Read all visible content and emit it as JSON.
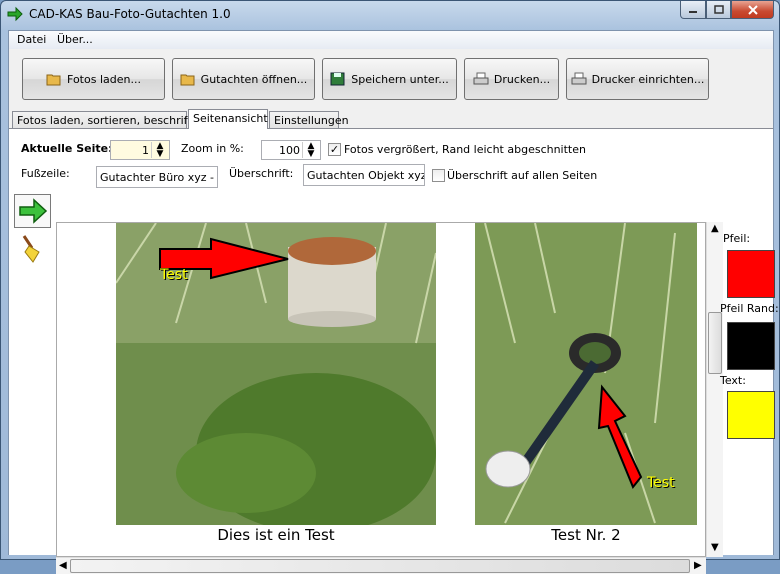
{
  "app": {
    "title": "CAD-KAS Bau-Foto-Gutachten 1.0"
  },
  "menu": [
    "Datei",
    "Über..."
  ],
  "toolbar": {
    "fotos_laden": "Fotos laden...",
    "gutachten_oeffnen": "Gutachten öffnen...",
    "speichern_unter": "Speichern unter...",
    "drucken": "Drucken...",
    "drucker_einrichten": "Drucker einrichten..."
  },
  "tabs": [
    "Fotos laden, sortieren, beschriften",
    "Seitenansicht",
    "Einstellungen"
  ],
  "active_tab": "Seitenansicht",
  "settings": {
    "aktuelle_seite_label": "Aktuelle Seite:",
    "aktuelle_seite_value": "1",
    "zoom_label": "Zoom in %:",
    "zoom_value": "100",
    "fotos_vergroessert_label": "Fotos vergrößert, Rand leicht abgeschnitten",
    "fotos_vergroessert_checked": true,
    "fusszeile_label": "Fußzeile:",
    "fusszeile_value": "Gutachter Büro xyz - Se",
    "ueberschrift_label": "Überschrift:",
    "ueberschrift_value": "Gutachten Objekt xyz",
    "ueberschrift_alle_label": "Überschrift auf allen Seiten",
    "ueberschrift_alle_checked": false
  },
  "page": {
    "photos": [
      {
        "caption": "Dies ist ein Test",
        "annotation": "Test"
      },
      {
        "caption": "Test Nr. 2",
        "annotation": "Test"
      }
    ]
  },
  "colors_panel": {
    "pfeil_label": "Pfeil:",
    "pfeil_color": "#ff0000",
    "pfeil_rand_label": "Pfeil Rand:",
    "pfeil_rand_color": "#000000",
    "text_label": "Text:",
    "text_color": "#ffff00"
  },
  "icons": [
    "app-arrow-icon",
    "folder-icon",
    "save-icon",
    "printer-icon",
    "arrow-tool-icon",
    "broom-icon"
  ]
}
